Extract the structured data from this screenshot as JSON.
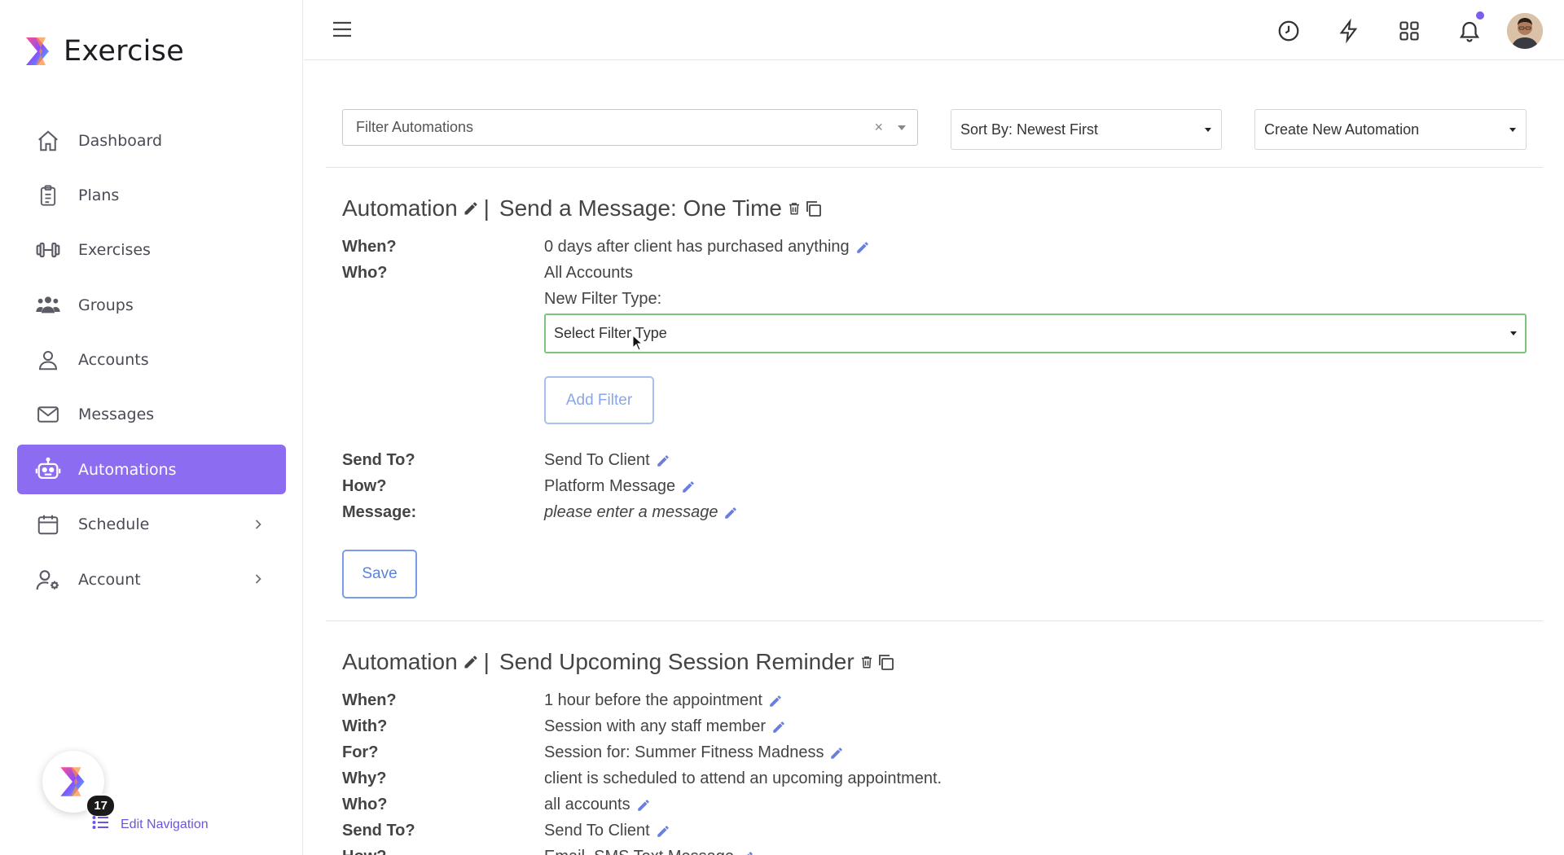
{
  "brand": {
    "name": "Exercise"
  },
  "sidebar": {
    "items": [
      {
        "label": "Dashboard",
        "icon": "home-icon"
      },
      {
        "label": "Plans",
        "icon": "clipboard-icon"
      },
      {
        "label": "Exercises",
        "icon": "dumbbell-icon"
      },
      {
        "label": "Groups",
        "icon": "users-icon"
      },
      {
        "label": "Accounts",
        "icon": "user-icon"
      },
      {
        "label": "Messages",
        "icon": "mail-icon"
      },
      {
        "label": "Automations",
        "icon": "robot-icon",
        "active": true
      },
      {
        "label": "Schedule",
        "icon": "calendar-icon",
        "expandable": true
      },
      {
        "label": "Account",
        "icon": "user-gear-icon",
        "expandable": true
      }
    ],
    "badge_count": "17",
    "edit_navigation": "Edit Navigation"
  },
  "topbar": {
    "icons": [
      "clock-icon",
      "lightning-icon",
      "grid-icon",
      "bell-icon"
    ],
    "accent_color": "#8c6cf0"
  },
  "filters": {
    "filter_placeholder": "Filter Automations",
    "clear_symbol": "×",
    "sort_label": "Sort By: Newest First",
    "create_label": "Create New Automation"
  },
  "automation1": {
    "title_prefix": "Automation",
    "separator": "|",
    "title": "Send a Message: One Time",
    "labels": {
      "when": "When?",
      "who": "Who?",
      "send_to": "Send To?",
      "how": "How?",
      "message": "Message:"
    },
    "values": {
      "when": "0 days after client has purchased anything",
      "who": "All Accounts",
      "send_to": "Send To Client",
      "how": "Platform Message",
      "message": "please enter a message"
    },
    "new_filter_label": "New Filter Type:",
    "filter_select": "Select Filter Type",
    "add_filter": "Add Filter",
    "save": "Save"
  },
  "automation2": {
    "title_prefix": "Automation",
    "separator": "|",
    "title": "Send Upcoming Session Reminder",
    "labels": {
      "when": "When?",
      "with": "With?",
      "for": "For?",
      "why": "Why?",
      "who": "Who?",
      "send_to": "Send To?",
      "how": "How?"
    },
    "values": {
      "when": "1 hour before the appointment",
      "with": "Session with any staff member",
      "for": "Session for: Summer Fitness Madness",
      "why": "client is scheduled to attend an upcoming appointment.",
      "who": "all accounts",
      "send_to": "Send To Client",
      "how": "Email, SMS Text Message"
    }
  }
}
